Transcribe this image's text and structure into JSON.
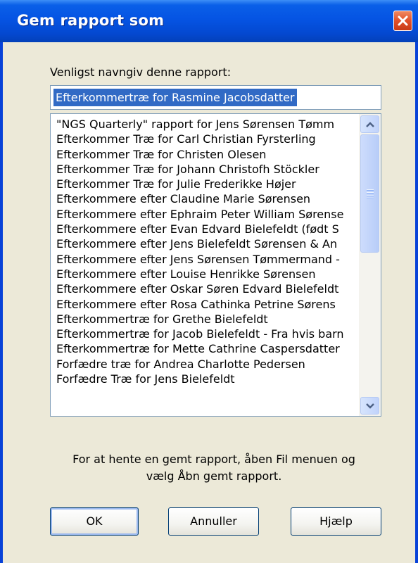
{
  "window": {
    "title": "Gem rapport som"
  },
  "form": {
    "prompt_label": "Venligst navngiv denne rapport:",
    "name_value": "Efterkommertræ for Rasmine Jacobsdatter"
  },
  "reports": [
    "\"NGS Quarterly\" rapport for Jens Sørensen Tømm",
    "Efterkommer Træ for Carl Christian Fyrsterling",
    "Efterkommer Træ for Christen Olesen",
    "Efterkommer Træ for Johann Christofh Stöckler",
    "Efterkommer Træ for Julie Frederikke Højer",
    "Efterkommere efter Claudine Marie Sørensen",
    "Efterkommere efter Ephraim Peter William Sørense",
    "Efterkommere efter Evan Edvard Bielefeldt (født S",
    "Efterkommere efter Jens Bielefeldt Sørensen & An",
    "Efterkommere efter Jens Sørensen Tømmermand -",
    "Efterkommere efter Louise Henrikke Sørensen",
    "Efterkommere efter Oskar Søren Edvard Bielefeldt",
    "Efterkommere efter Rosa Cathinka Petrine Sørens",
    "Efterkommertræ for Grethe Bielefeldt",
    "Efterkommertræ for Jacob Bielefeldt - Fra hvis barn",
    "Efterkommertræ for Mette Cathrine Caspersdatter",
    "Forfædre træ for Andrea Charlotte Pedersen",
    "Forfædre Træ for Jens Bielefeldt"
  ],
  "info": {
    "line1": "For at hente en gemt rapport, åben Fil menuen og",
    "line2": "vælg Åbn gemt rapport."
  },
  "buttons": {
    "ok": "OK",
    "cancel": "Annuller",
    "help": "Hjælp"
  },
  "colors": {
    "titlebar": "#0554e3",
    "selection": "#316ac5",
    "dialog_bg": "#ece9d8",
    "close_button": "#e0502a"
  },
  "icons": {
    "close": "close-icon",
    "scroll_up": "chevron-up-icon",
    "scroll_down": "chevron-down-icon"
  }
}
